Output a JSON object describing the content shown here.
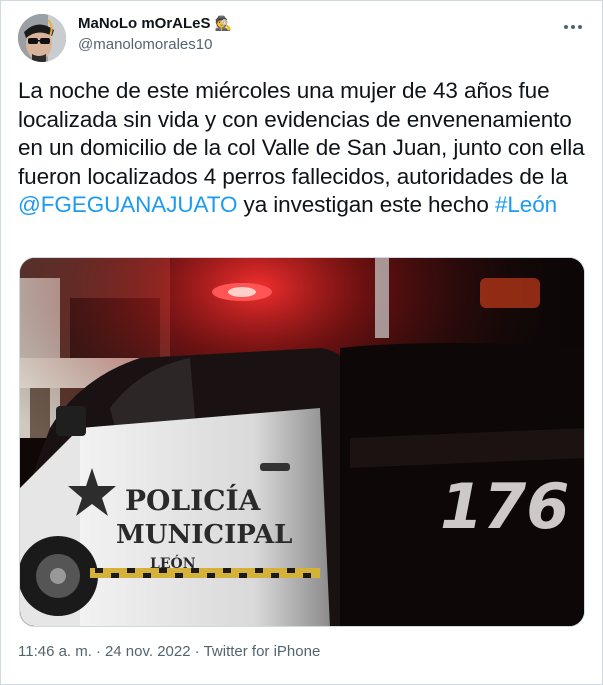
{
  "tweet": {
    "author": {
      "display_name": "MaNoLo mOrALeS",
      "name_emoji": "🕵️",
      "handle": "@manolomorales10"
    },
    "text_segments": [
      {
        "text": "La noche de este miércoles una mujer de 43 años fue localizada sin vida y con evidencias de envenenamiento en un domicilio de la col Valle de San Juan, junto con ella fueron localizados 4 perros fallecidos, autoridades de la ",
        "link": false
      },
      {
        "text": "@FGEGUANAJUATO",
        "link": true
      },
      {
        "text": " ya investigan este hecho ",
        "link": false
      },
      {
        "text": "#León",
        "link": true
      }
    ],
    "media": {
      "vehicle_text_line1": "POLICÍA",
      "vehicle_text_line2": "MUNICIPAL",
      "vehicle_text_line3": "LEÓN",
      "unit_number": "176"
    },
    "time": "11:46 a. m.",
    "separator": "·",
    "date": "24 nov. 2022",
    "source": "Twitter for iPhone"
  },
  "colors": {
    "link": "#1d9bf0",
    "text": "#0f1419",
    "secondary": "#536471"
  },
  "icons": {
    "more": "more-horizontal-icon"
  }
}
